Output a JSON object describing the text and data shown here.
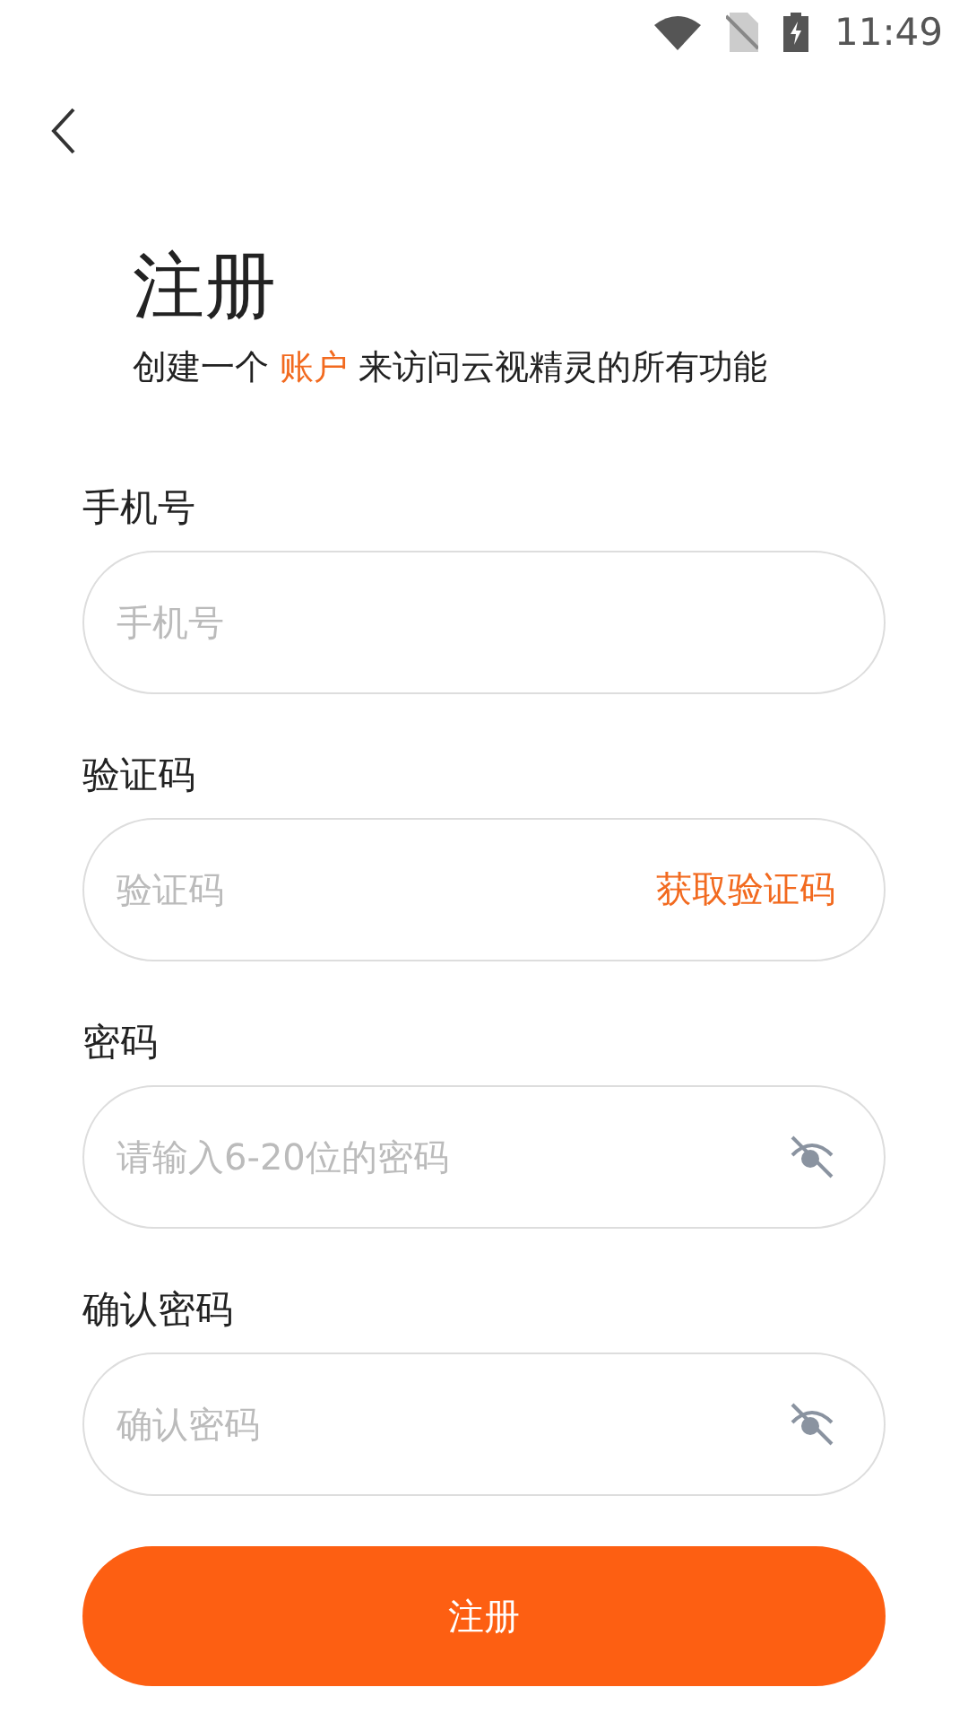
{
  "status_bar": {
    "time": "11:49"
  },
  "header": {
    "title": "注册",
    "subtitle": {
      "before": "创建一个",
      "link": "账户",
      "after": "来访问云视精灵的所有功能"
    }
  },
  "fields": [
    {
      "kind": "plain",
      "label": "手机号",
      "placeholder": "手机号"
    },
    {
      "kind": "code",
      "label": "验证码",
      "placeholder": "验证码",
      "action": "获取验证码"
    },
    {
      "kind": "password",
      "label": "密码",
      "placeholder": "请输入6-20位的密码",
      "visible": false
    },
    {
      "kind": "password",
      "label": "确认密码",
      "placeholder": "确认密码",
      "visible": false
    }
  ],
  "submit": {
    "label": "注册"
  }
}
